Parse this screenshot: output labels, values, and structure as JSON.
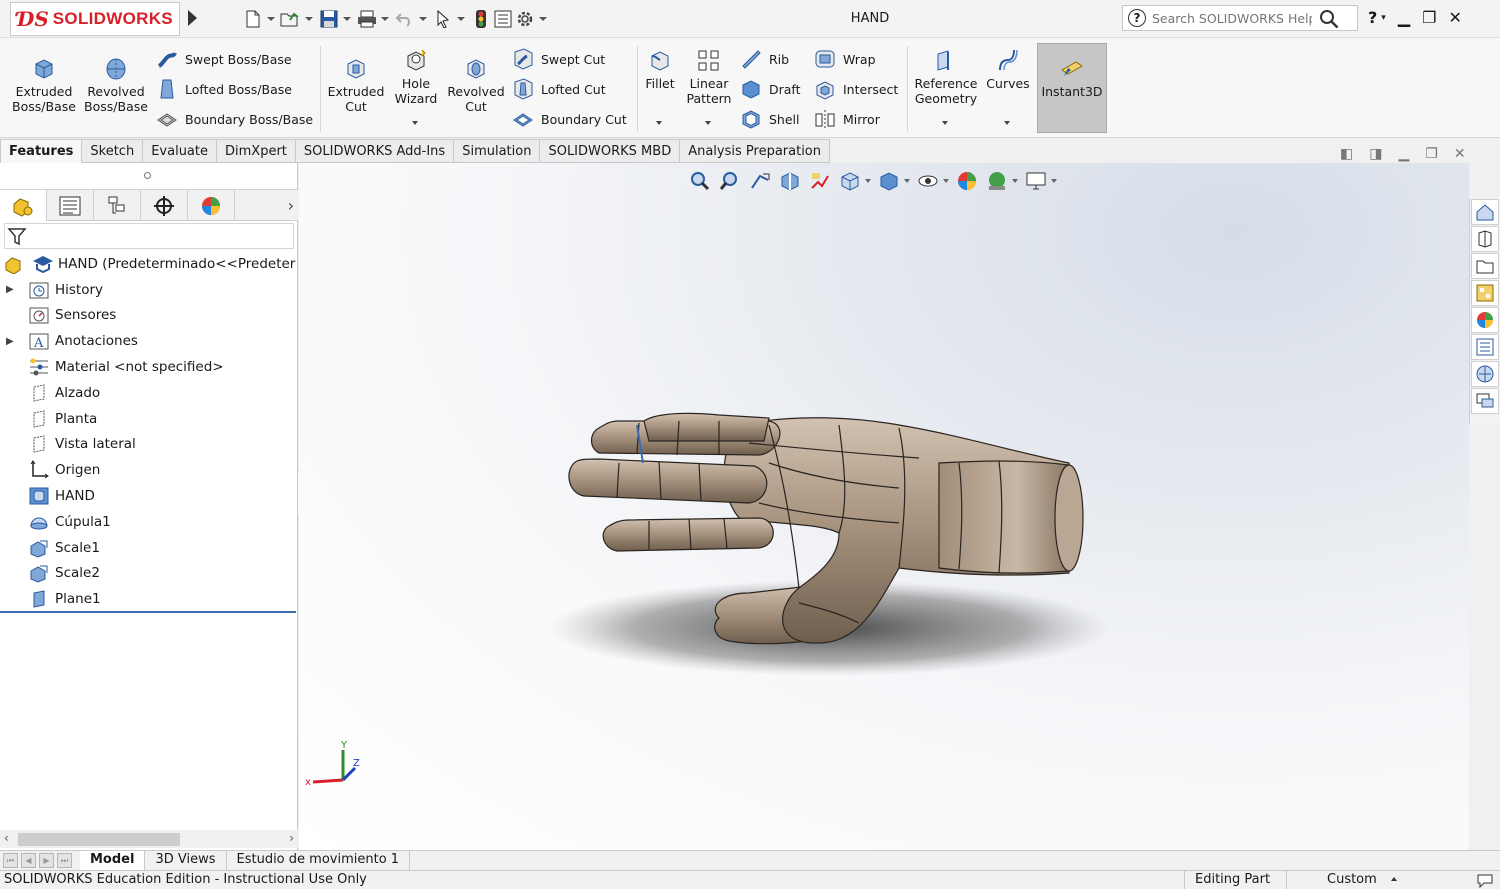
{
  "app": {
    "brand": "SOLIDWORKS",
    "document_title": "HAND",
    "search_placeholder": "Search SOLIDWORKS Help"
  },
  "quick_access": [
    "new-icon",
    "open-icon",
    "save-icon",
    "print-icon",
    "undo-icon",
    "select-icon",
    "rebuild-icon",
    "file-properties-icon",
    "options-icon"
  ],
  "command_manager": {
    "extruded_boss": "Extruded Boss/Base",
    "revolved_boss": "Revolved Boss/Base",
    "swept_boss": "Swept Boss/Base",
    "lofted_boss": "Lofted Boss/Base",
    "boundary_boss": "Boundary Boss/Base",
    "extruded_cut": "Extruded Cut",
    "hole_wizard": "Hole Wizard",
    "revolved_cut": "Revolved Cut",
    "swept_cut": "Swept Cut",
    "lofted_cut": "Lofted Cut",
    "boundary_cut": "Boundary Cut",
    "fillet": "Fillet",
    "linear_pattern": "Linear Pattern",
    "rib": "Rib",
    "draft": "Draft",
    "shell": "Shell",
    "wrap": "Wrap",
    "intersect": "Intersect",
    "mirror": "Mirror",
    "reference_geometry": "Reference Geometry",
    "curves": "Curves",
    "instant3d": "Instant3D"
  },
  "tabs": [
    "Features",
    "Sketch",
    "Evaluate",
    "DimXpert",
    "SOLIDWORKS Add-Ins",
    "Simulation",
    "SOLIDWORKS MBD",
    "Analysis Preparation"
  ],
  "active_tab": "Features",
  "tree": {
    "root": "HAND  (Predeterminado<<Predetermi",
    "items": [
      {
        "label": "History",
        "expandable": true,
        "icon": "history-folder-icon"
      },
      {
        "label": "Sensores",
        "expandable": false,
        "icon": "sensors-icon"
      },
      {
        "label": "Anotaciones",
        "expandable": true,
        "icon": "annotations-icon"
      },
      {
        "label": "Material <not specified>",
        "expandable": false,
        "icon": "material-icon"
      },
      {
        "label": "Alzado",
        "expandable": false,
        "icon": "plane-icon"
      },
      {
        "label": "Planta",
        "expandable": false,
        "icon": "plane-icon"
      },
      {
        "label": "Vista lateral",
        "expandable": false,
        "icon": "plane-icon"
      },
      {
        "label": "Origen",
        "expandable": false,
        "icon": "origin-icon"
      },
      {
        "label": "HAND",
        "expandable": false,
        "icon": "body-feature-icon"
      },
      {
        "label": "Cúpula1",
        "expandable": false,
        "icon": "dome-icon"
      },
      {
        "label": "Scale1",
        "expandable": false,
        "icon": "scale-icon"
      },
      {
        "label": "Scale2",
        "expandable": false,
        "icon": "scale-icon"
      },
      {
        "label": "Plane1",
        "expandable": false,
        "icon": "plane-icon"
      }
    ]
  },
  "bottom_tabs": [
    "Model",
    "3D Views",
    "Estudio de movimiento 1"
  ],
  "active_bottom_tab": "Model",
  "status": {
    "left": "SOLIDWORKS Education Edition - Instructional Use Only",
    "editing": "Editing Part",
    "units": "Custom"
  },
  "colors": {
    "brand_red": "#d8202a",
    "model_bronze": "#a08c78",
    "selection_blue": "#3d6bb3"
  }
}
